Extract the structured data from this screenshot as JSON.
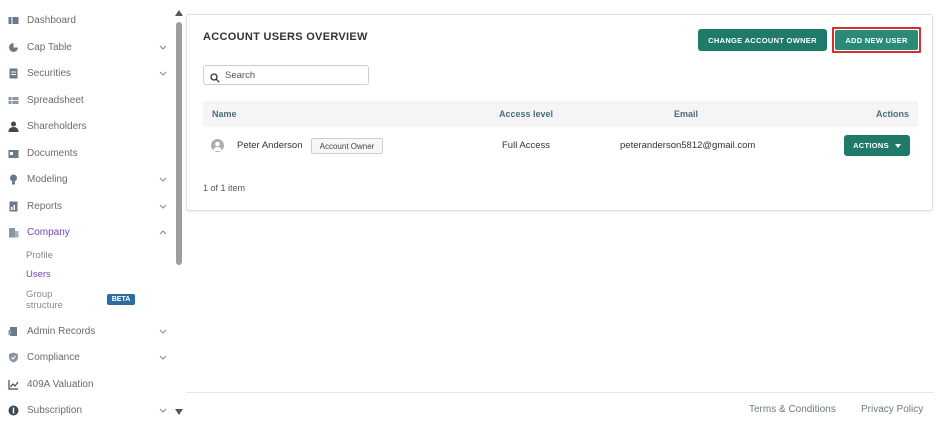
{
  "sidebar": {
    "items": [
      {
        "label": "Dashboard",
        "icon": "dashboard-icon"
      },
      {
        "label": "Cap Table",
        "icon": "pie-chart-icon"
      },
      {
        "label": "Securities",
        "icon": "document-icon"
      },
      {
        "label": "Spreadsheet",
        "icon": "grid-icon"
      },
      {
        "label": "Shareholders",
        "icon": "person-icon"
      },
      {
        "label": "Documents",
        "icon": "folder-icon"
      },
      {
        "label": "Modeling",
        "icon": "lightbulb-icon"
      },
      {
        "label": "Reports",
        "icon": "report-icon"
      },
      {
        "label": "Company",
        "icon": "building-icon"
      },
      {
        "label": "Admin Records",
        "icon": "records-icon"
      },
      {
        "label": "Compliance",
        "icon": "shield-icon"
      },
      {
        "label": "409A Valuation",
        "icon": "chart-icon"
      },
      {
        "label": "Subscription",
        "icon": "dollar-icon"
      }
    ],
    "company_sub": {
      "profile": "Profile",
      "users": "Users",
      "group_line1": "Group",
      "group_line2": "structure",
      "beta": "BETA"
    }
  },
  "card": {
    "title": "ACCOUNT USERS OVERVIEW",
    "change_owner_label": "CHANGE ACCOUNT OWNER",
    "add_user_label": "ADD NEW USER",
    "search_placeholder": "Search",
    "columns": {
      "name": "Name",
      "access": "Access level",
      "email": "Email",
      "actions": "Actions"
    },
    "rows": [
      {
        "name": "Peter Anderson",
        "badge": "Account Owner",
        "access": "Full Access",
        "email": "peteranderson5812@gmail.com",
        "actions_label": "ACTIONS"
      }
    ],
    "pagination": "1 of 1 item"
  },
  "footer": {
    "terms": "Terms & Conditions",
    "privacy": "Privacy Policy"
  },
  "colors": {
    "accent_purple": "#6b46c1",
    "primary_green": "#1f7a6a",
    "highlight_red": "#d32f2f",
    "beta_blue": "#2e6da4"
  }
}
